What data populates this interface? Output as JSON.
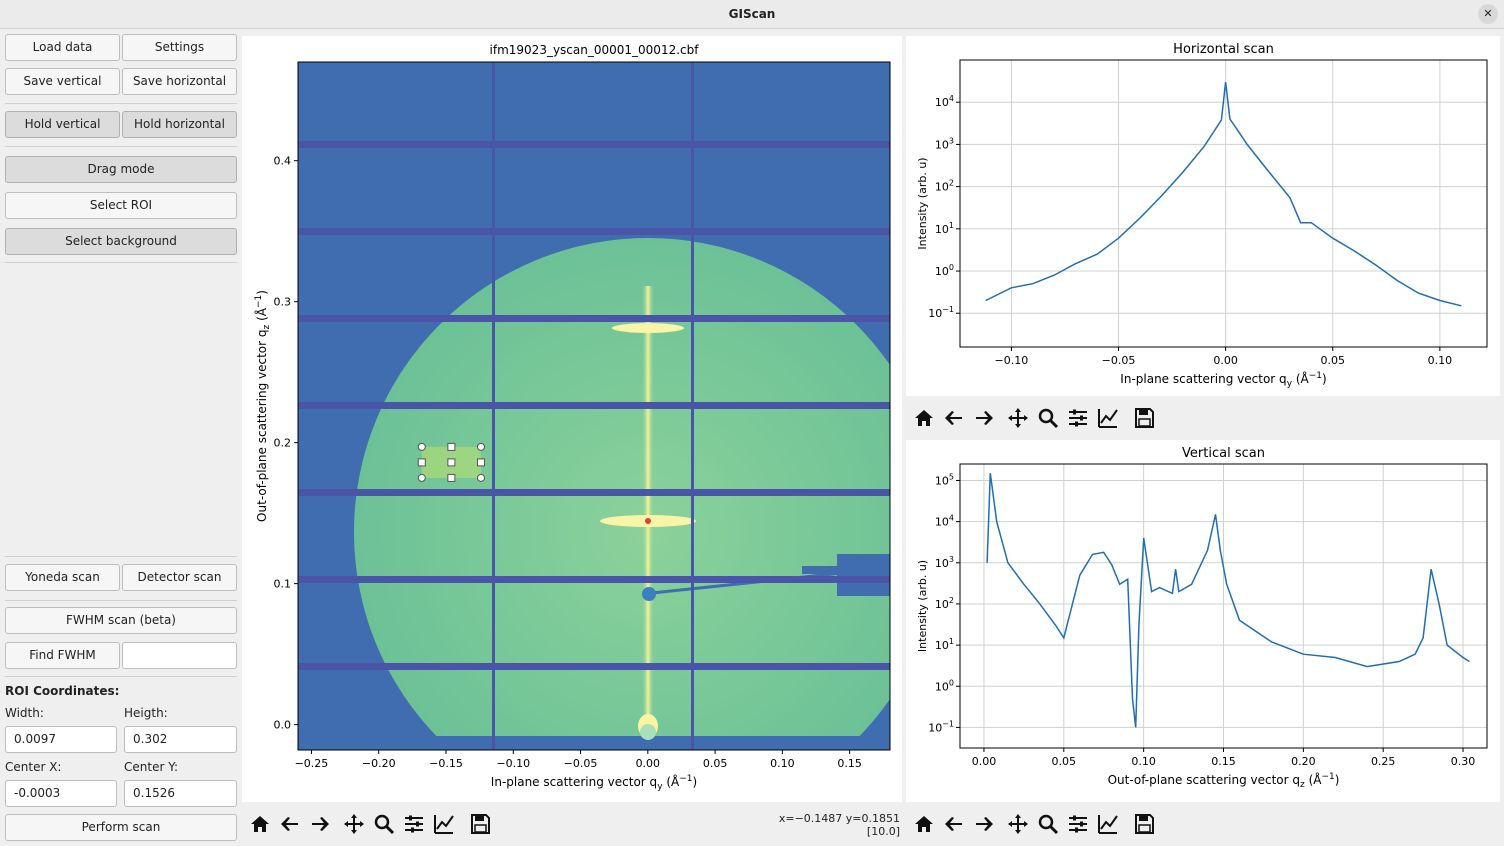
{
  "window": {
    "title": "GIScan",
    "close_glyph": "✕"
  },
  "sidebar": {
    "load_data": "Load data",
    "settings": "Settings",
    "save_vertical": "Save vertical",
    "save_horizontal": "Save horizontal",
    "hold_vertical": "Hold vertical",
    "hold_horizontal": "Hold horizontal",
    "drag_mode": "Drag mode",
    "select_roi": "Select ROI",
    "select_background": "Select background",
    "yoneda_scan": "Yoneda scan",
    "detector_scan": "Detector scan",
    "fwhm_scan": "FWHM scan (beta)",
    "find_fwhm": "Find FWHM",
    "find_fwhm_value": "",
    "roi_heading": "ROI Coordinates:",
    "width_label": "Width:",
    "height_label": "Heigth:",
    "width_value": "0.0097",
    "height_value": "0.302",
    "center_x_label": "Center X:",
    "center_y_label": "Center Y:",
    "center_x_value": "-0.0003",
    "center_y_value": "0.1526",
    "perform_scan": "Perform scan"
  },
  "toolbar_icons": [
    "home-icon",
    "back-arrow-icon",
    "forward-arrow-icon",
    "pan-icon",
    "zoom-icon",
    "configure-subplots-icon",
    "edit-axis-icon",
    "save-icon"
  ],
  "status": {
    "cursor": "x=−0.1487 y=0.1851",
    "value": "[10.0]"
  },
  "colors": {
    "accent_line": "#1f6fb0",
    "detector_bg": "#3f6db0",
    "gap": "#4a55a8"
  },
  "chart_data": [
    {
      "type": "heatmap",
      "title": "ifm19023_yscan_00001_00012.cbf",
      "xlabel": "In-plane scattering vector q",
      "xlabel_sub": "y",
      "xlabel_unit": " (Å",
      "ylabel": "Out-of-plane scattering vector q",
      "ylabel_sub": "z",
      "xlim": [
        -0.26,
        0.18
      ],
      "ylim": [
        -0.018,
        0.47
      ],
      "xticks": [
        "−0.25",
        "−0.20",
        "−0.15",
        "−0.10",
        "−0.05",
        "0.00",
        "0.05",
        "0.10",
        "0.15"
      ],
      "xtick_values": [
        -0.25,
        -0.2,
        -0.15,
        -0.1,
        -0.05,
        0.0,
        0.05,
        0.1,
        0.15
      ],
      "yticks": [
        "0.0",
        "0.1",
        "0.2",
        "0.3",
        "0.4"
      ],
      "ytick_values": [
        0.0,
        0.1,
        0.2,
        0.3,
        0.4
      ],
      "roi": {
        "x0": -0.168,
        "x1": -0.124,
        "y0": 0.175,
        "y1": 0.197
      }
    },
    {
      "type": "line",
      "title": "Horizontal scan",
      "xlabel": "In-plane scattering vector q",
      "xlabel_sub": "y",
      "ylabel": "Intensity (arb. u)",
      "yscale": "log",
      "xlim": [
        -0.124,
        0.122
      ],
      "ylim_exp": [
        -1.8,
        5.0
      ],
      "xticks": [
        "−0.10",
        "−0.05",
        "0.00",
        "0.05",
        "0.10"
      ],
      "xtick_values": [
        -0.1,
        -0.05,
        0.0,
        0.05,
        0.1
      ],
      "ytick_exps": [
        -1,
        0,
        1,
        2,
        3,
        4
      ],
      "grid": true,
      "x": [
        -0.112,
        -0.1,
        -0.09,
        -0.08,
        -0.07,
        -0.06,
        -0.05,
        -0.04,
        -0.03,
        -0.02,
        -0.01,
        -0.005,
        -0.002,
        0.0,
        0.002,
        0.005,
        0.01,
        0.02,
        0.03,
        0.035,
        0.04,
        0.05,
        0.06,
        0.07,
        0.08,
        0.09,
        0.1,
        0.11
      ],
      "y": [
        0.2,
        0.4,
        0.5,
        0.8,
        1.5,
        2.5,
        6,
        18,
        60,
        220,
        900,
        2200,
        3800,
        30000,
        4000,
        2400,
        1000,
        230,
        55,
        14,
        14,
        6,
        3,
        1.4,
        0.6,
        0.3,
        0.2,
        0.15
      ]
    },
    {
      "type": "line",
      "title": "Vertical scan",
      "xlabel": "Out-of-plane scattering vector q",
      "xlabel_sub": "z",
      "ylabel": "Intensity (arb. u)",
      "yscale": "log",
      "xlim": [
        -0.015,
        0.315
      ],
      "ylim_exp": [
        -1.5,
        5.4
      ],
      "xticks": [
        "0.00",
        "0.05",
        "0.10",
        "0.15",
        "0.20",
        "0.25",
        "0.30"
      ],
      "xtick_values": [
        0.0,
        0.05,
        0.1,
        0.15,
        0.2,
        0.25,
        0.3
      ],
      "ytick_exps": [
        -1,
        0,
        1,
        2,
        3,
        4,
        5
      ],
      "grid": true,
      "x": [
        0.002,
        0.004,
        0.008,
        0.015,
        0.025,
        0.035,
        0.045,
        0.05,
        0.06,
        0.068,
        0.075,
        0.08,
        0.085,
        0.09,
        0.093,
        0.095,
        0.097,
        0.1,
        0.105,
        0.11,
        0.118,
        0.12,
        0.122,
        0.13,
        0.14,
        0.145,
        0.148,
        0.152,
        0.16,
        0.18,
        0.2,
        0.22,
        0.24,
        0.26,
        0.27,
        0.275,
        0.28,
        0.285,
        0.29,
        0.3,
        0.304
      ],
      "y": [
        1000,
        150000,
        10000,
        1000,
        300,
        100,
        30,
        15,
        500,
        1600,
        1800,
        900,
        300,
        400,
        0.5,
        0.1,
        30,
        4000,
        200,
        250,
        180,
        700,
        200,
        300,
        2000,
        15000,
        2000,
        300,
        40,
        12,
        6,
        5,
        3,
        4,
        6,
        15,
        700,
        100,
        10,
        5,
        4
      ]
    }
  ]
}
